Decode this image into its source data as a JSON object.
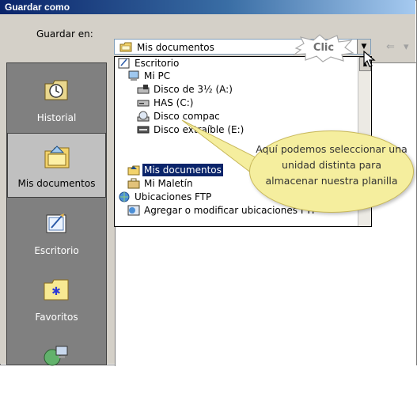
{
  "window": {
    "title": "Guardar como"
  },
  "save_in": {
    "label": "Guardar en:",
    "value": "Mis documentos"
  },
  "places": [
    {
      "label": "Historial",
      "icon": "history-icon"
    },
    {
      "label": "Mis documentos",
      "icon": "my-documents-icon",
      "selected": true
    },
    {
      "label": "Escritorio",
      "icon": "desktop-icon"
    },
    {
      "label": "Favoritos",
      "icon": "favorites-icon"
    },
    {
      "label": "",
      "icon": "network-places-icon"
    }
  ],
  "dropdown": {
    "items": [
      {
        "label": "Escritorio",
        "icon": "desktop-icon"
      },
      {
        "label": "Mi PC",
        "icon": "my-computer-icon"
      },
      {
        "label": "Disco de 3½ (A:)",
        "icon": "floppy-drive-icon"
      },
      {
        "label": "HAS (C:)",
        "icon": "hard-drive-icon"
      },
      {
        "label": "Disco compac",
        "icon": "cd-drive-icon"
      },
      {
        "label": "Disco extraíble (E:)",
        "icon": "removable-drive-icon"
      },
      {
        "label": "Mis documentos",
        "icon": "my-documents-icon",
        "selected": true
      },
      {
        "label": "Mi Maletín",
        "icon": "briefcase-icon"
      },
      {
        "label": "Ubicaciones FTP",
        "icon": "ftp-icon"
      },
      {
        "label": "Agregar o modificar ubicaciones FTP",
        "icon": "ftp-add-icon"
      }
    ]
  },
  "callout": {
    "clic": "Clic",
    "tooltip": "Aquí podemos seleccionar una unidad distinta para almacenar nuestra planilla"
  },
  "colors": {
    "title_start": "#0a246a",
    "selection": "#0a246a",
    "tooltip": "#f5ee9e",
    "dialog_bg": "#d4d0c8"
  }
}
